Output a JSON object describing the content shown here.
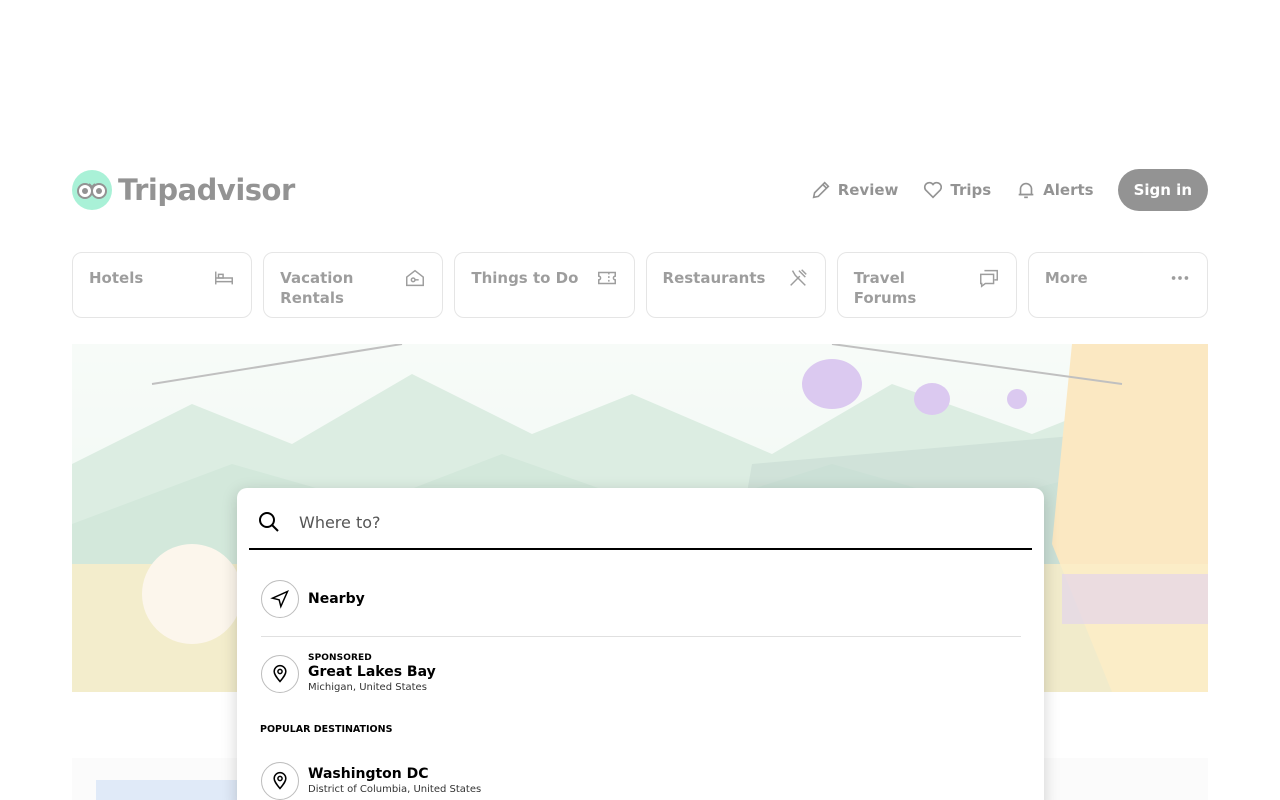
{
  "header": {
    "logo_text": "Tripadvisor",
    "nav": [
      {
        "label": "Review",
        "icon": "pencil-icon"
      },
      {
        "label": "Trips",
        "icon": "heart-icon"
      },
      {
        "label": "Alerts",
        "icon": "bell-icon"
      }
    ],
    "signin_label": "Sign in"
  },
  "categories": [
    {
      "label": "Hotels",
      "icon": "bed-icon"
    },
    {
      "label": "Vacation Rentals",
      "icon": "house-icon"
    },
    {
      "label": "Things to Do",
      "icon": "ticket-icon"
    },
    {
      "label": "Restaurants",
      "icon": "utensils-icon"
    },
    {
      "label": "Travel Forums",
      "icon": "chat-icon"
    },
    {
      "label": "More",
      "icon": "more-icon"
    }
  ],
  "search": {
    "placeholder": "Where to?",
    "value": ""
  },
  "dropdown": {
    "nearby_label": "Nearby",
    "sponsored": {
      "tag": "SPONSORED",
      "title": "Great Lakes Bay",
      "subtitle": "Michigan, United States"
    },
    "section_label": "POPULAR DESTINATIONS",
    "destinations": [
      {
        "title": "Washington DC",
        "subtitle": "District of Columbia, United States"
      }
    ]
  },
  "colors": {
    "brand": "#34e0a1",
    "text": "#000000",
    "border": "#bdbdbd"
  }
}
